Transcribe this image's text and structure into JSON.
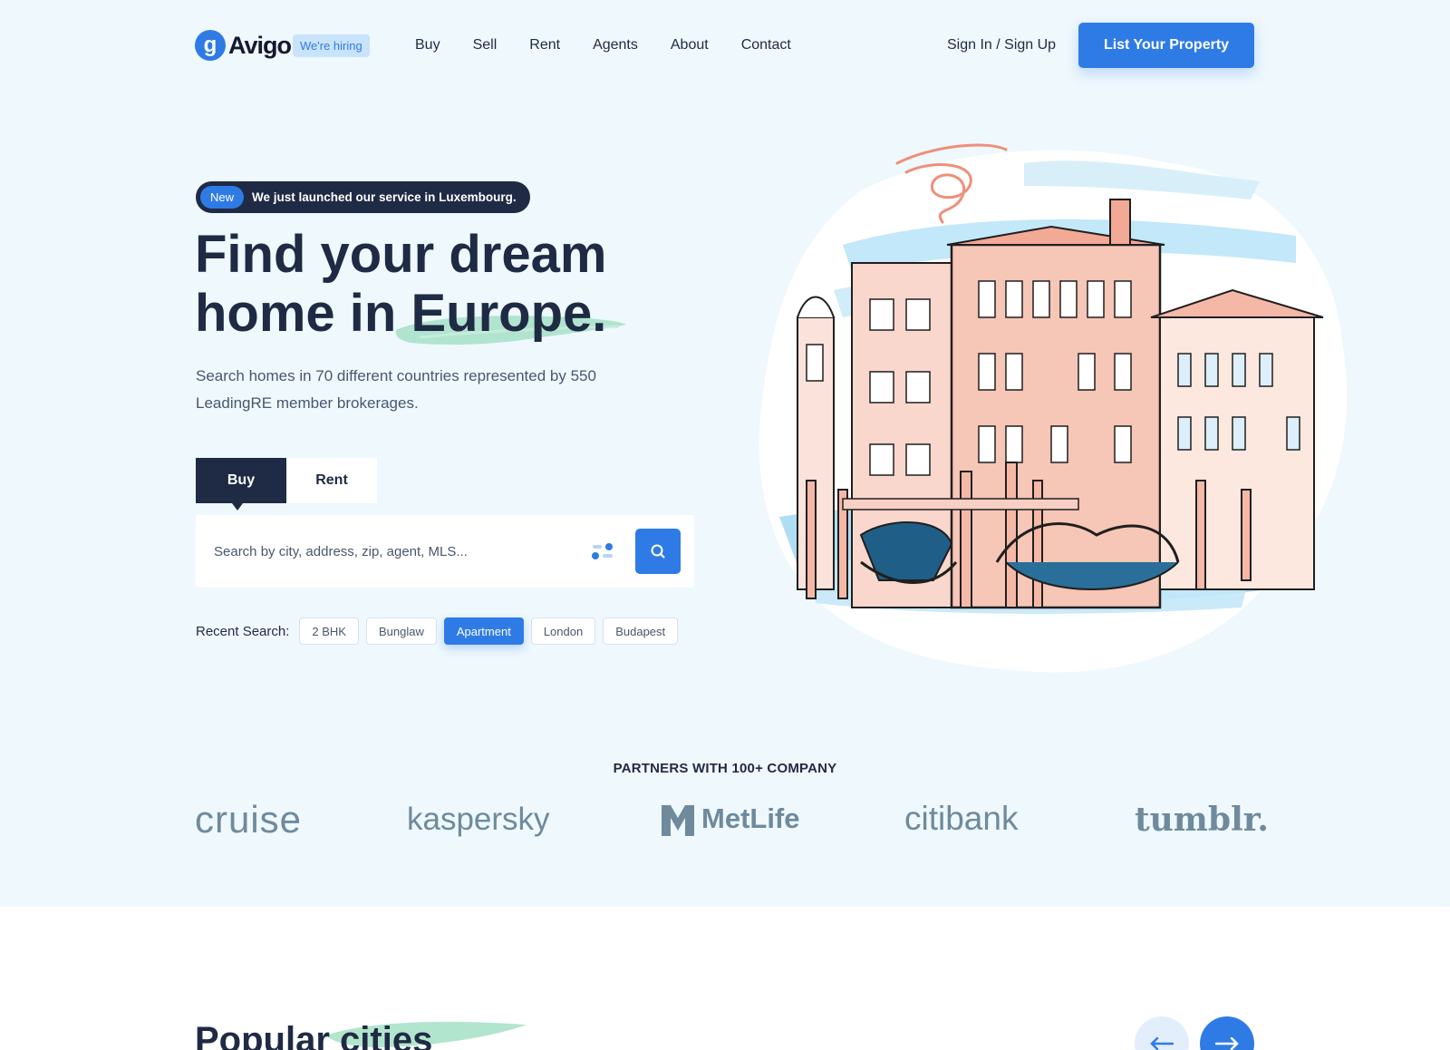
{
  "brand": {
    "logo_letter": "g",
    "name": "Avigo",
    "hiring_badge": "We're hiring"
  },
  "nav": {
    "links": [
      "Buy",
      "Sell",
      "Rent",
      "Agents",
      "About",
      "Contact"
    ],
    "signin": "Sign In / Sign Up",
    "cta": "List Your Property"
  },
  "hero": {
    "announce_badge": "New",
    "announce_text": "We just launched our service in Luxembourg.",
    "headline_line1": "Find your dream",
    "headline_line2_prefix": "home in ",
    "headline_highlight": "Europe.",
    "subtext": "Search homes in 70 different countries represented by 550 LeadingRE member brokerages.",
    "tabs": [
      "Buy",
      "Rent"
    ],
    "active_tab": "Buy",
    "search_placeholder": "Search by city, address, zip, agent, MLS...",
    "recent_label": "Recent Search:",
    "recent_chips": [
      "2 BHK",
      "Bunglaw",
      "Apartment",
      "London",
      "Budapest"
    ],
    "active_chip": "Apartment"
  },
  "partners": {
    "title": "PARTNERS WITH 100+ COMPANY",
    "logos": [
      "cruise",
      "kaspersky",
      "MetLife",
      "citibank",
      "tumblr."
    ]
  },
  "popular": {
    "title_prefix": "Popular ",
    "title_highlight": "cities"
  },
  "colors": {
    "accent": "#2f7be6",
    "dark": "#1f2a44",
    "hero_bg": "#eef8fd",
    "highlight_brush": "#9fdcc0"
  },
  "icons": {
    "search": "search-icon",
    "filter": "filter-icon",
    "arrow_prev": "arrow-left-icon",
    "arrow_next": "arrow-right-icon"
  }
}
